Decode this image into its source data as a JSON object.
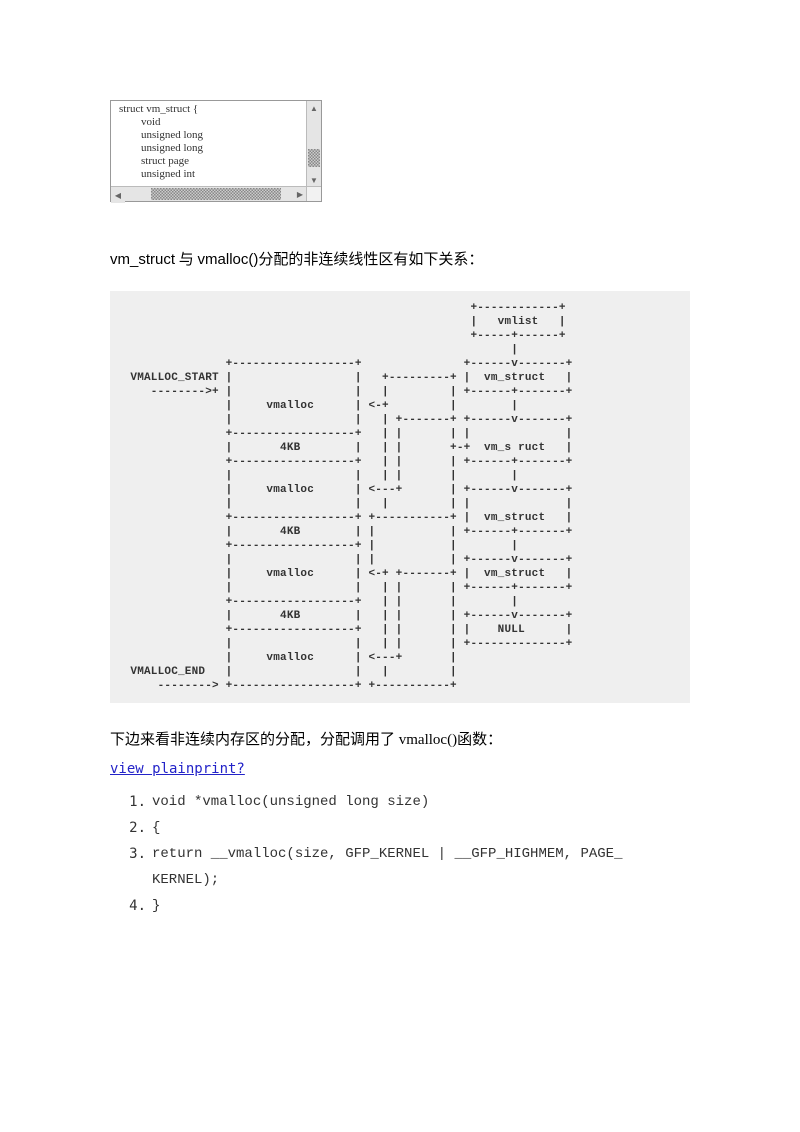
{
  "codebox": {
    "line1": "struct vm_struct {",
    "line2": "        void",
    "line3": "        unsigned long",
    "line4": "        unsigned long",
    "line5": "        struct page",
    "line6": "        unsigned int"
  },
  "para1_prefix": "  vm_struct",
  "para1_mid": " 与 ",
  "para1_vmalloc": "vmalloc()",
  "para1_suffix": "分配的非连续线性区有如下关系：",
  "diagram": "                                                     +------------+\n                                                     |   vmlist   |\n                                                     +-----+------+\n                                                           |\n                 +------------------+               +------v-------+\n   VMALLOC_START |                  |   +---------+ |  vm_struct   |\n      -------->+ |                  |   |         | +------+-------+\n                 |     vmalloc      | <-+         |        |\n                 |                  |   | +-------+ +------v-------+\n                 +------------------+   | |       | |              |\n                 |       4KB        |   | |       +-+  vm_s ruct   |\n                 +------------------+   | |       | +------+-------+\n                 |                  |   | |       |        |\n                 |     vmalloc      | <---+       | +------v-------+\n                 |                  |   |         | |              |\n                 +------------------+ +-----------+ |  vm_struct   |\n                 |       4KB        | |           | +------+-------+\n                 +------------------+ |           |        |\n                 |                  | |           | +------v-------+\n                 |     vmalloc      | <-+ +-------+ |  vm_struct   |\n                 |                  |   | |       | +------+-------+\n                 +------------------+   | |       |        |\n                 |       4KB        |   | |       | +------v-------+\n                 +------------------+   | |       | |    NULL      |\n                 |                  |   | |       | +--------------+\n                 |     vmalloc      | <---+       |\n   VMALLOC_END   |                  |   |         |\n       --------> +------------------+ +-----------+",
  "para2_prefix": "  下边来看非连续内存区的分配，分配调用了 ",
  "para2_vmalloc": "vmalloc()",
  "para2_suffix": "函数：",
  "link": "view plainprint?",
  "code": {
    "n1": "1.",
    "l1": "void *vmalloc(unsigned long size)",
    "n2": "2.",
    "l2": "{",
    "n3": "3.",
    "l3a": "        return __vmalloc(size, GFP_KERNEL | __GFP_HIGHMEM, PAGE_",
    "l3b": "KERNEL);",
    "n4": "4.",
    "l4": "}"
  }
}
